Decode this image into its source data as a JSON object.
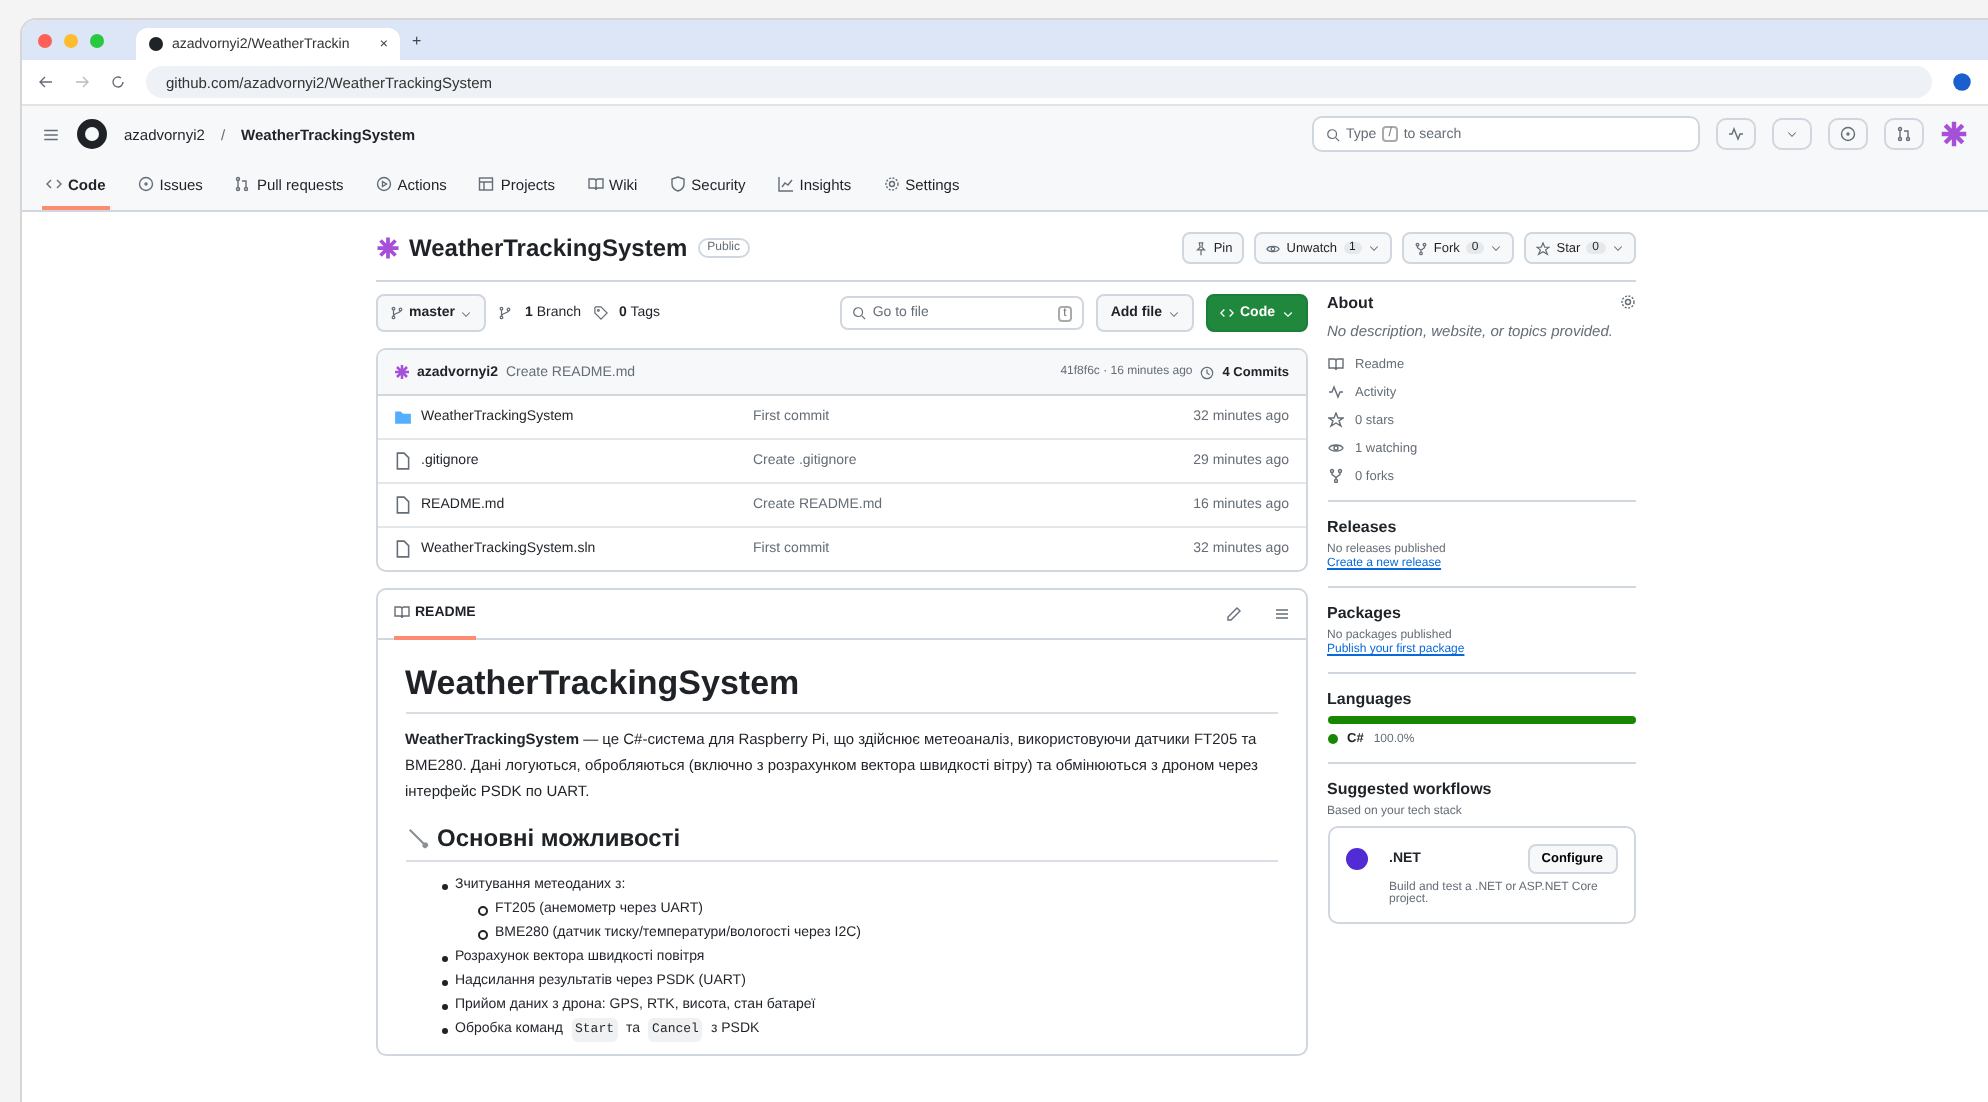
{
  "browser": {
    "tab_title": "azadvornyi2/WeatherTrackin",
    "tab_close": "×",
    "new_tab": "+",
    "url": "github.com/azadvornyi2/WeatherTrackingSystem"
  },
  "header": {
    "owner": "azadvornyi2",
    "separator": "/",
    "repo": "WeatherTrackingSystem",
    "search_prefix": "Type",
    "search_key": "/",
    "search_suffix": "to search"
  },
  "repo_nav": [
    {
      "label": "Code",
      "kind": "code",
      "selected": true
    },
    {
      "label": "Issues",
      "kind": "circle",
      "selected": false
    },
    {
      "label": "Pull requests",
      "kind": "pr",
      "selected": false
    },
    {
      "label": "Actions",
      "kind": "play",
      "selected": false
    },
    {
      "label": "Projects",
      "kind": "table",
      "selected": false
    },
    {
      "label": "Wiki",
      "kind": "book",
      "selected": false
    },
    {
      "label": "Security",
      "kind": "shield",
      "selected": false
    },
    {
      "label": "Insights",
      "kind": "graph",
      "selected": false
    },
    {
      "label": "Settings",
      "kind": "gear",
      "selected": false
    }
  ],
  "repo": {
    "name": "WeatherTrackingSystem",
    "visibility": "Public",
    "actions": [
      {
        "label": "Pin",
        "kind": "pin"
      },
      {
        "label": "Unwatch",
        "kind": "eye",
        "count": "1"
      },
      {
        "label": "Fork",
        "kind": "fork",
        "count": "0"
      },
      {
        "label": "Star",
        "kind": "star",
        "count": "0"
      }
    ]
  },
  "toolbar": {
    "branch": "master",
    "branches": "1",
    "branches_label": "Branch",
    "tags": "0",
    "tags_label": "Tags",
    "go_to_file": "Go to file",
    "shortcut": "t",
    "add_file": "Add file",
    "code": "Code"
  },
  "commit": {
    "author": "azadvornyi2",
    "message": "Create README.md",
    "meta": "41f8f6c · 16 minutes ago",
    "commits": "4 Commits"
  },
  "files": [
    {
      "kind": "folder",
      "name": "WeatherTrackingSystem",
      "message": "First commit",
      "time": "32 minutes ago"
    },
    {
      "kind": "file",
      "name": ".gitignore",
      "message": "Create .gitignore",
      "time": "29 minutes ago"
    },
    {
      "kind": "file",
      "name": "README.md",
      "message": "Create README.md",
      "time": "16 minutes ago"
    },
    {
      "kind": "file",
      "name": "WeatherTrackingSystem.sln",
      "message": "First commit",
      "time": "32 minutes ago"
    }
  ],
  "readme": {
    "tab": "README",
    "title": "WeatherTrackingSystem",
    "intro": "**WeatherTrackingSystem** — це C#-система для Raspberry Pi, що здійснює метеоаналіз, використовуючи датчики FT205 та BME280. Дані логуються, обробляються (включно з розрахунком вектора швидкості вітру) та обмінюються з дроном через інтерфейс PSDK по UART.",
    "heading": "Основні можливості",
    "items": [
      {
        "parts": [
          {
            "kind": "text",
            "text": "Зчитування метеоданих з:"
          }
        ],
        "children": [
          {
            "parts": [
              {
                "kind": "text",
                "text": "FT205 (анемометр через UART)"
              }
            ]
          },
          {
            "parts": [
              {
                "kind": "text",
                "text": "BME280 (датчик тиску/температури/вологості через I2C)"
              }
            ]
          }
        ]
      },
      {
        "parts": [
          {
            "kind": "text",
            "text": "Розрахунок вектора швидкості повітря"
          }
        ]
      },
      {
        "parts": [
          {
            "kind": "text",
            "text": "Надсилання результатів через PSDK (UART)"
          }
        ]
      },
      {
        "parts": [
          {
            "kind": "text",
            "text": "Прийом даних з дрона: GPS, RTK, висота, стан батареї"
          }
        ]
      },
      {
        "parts": [
          {
            "kind": "text",
            "text": "Обробка команд"
          },
          {
            "kind": "code",
            "text": "Start"
          },
          {
            "kind": "text",
            "text": "та"
          },
          {
            "kind": "code",
            "text": "Cancel"
          },
          {
            "kind": "text",
            "text": "з PSDK"
          }
        ]
      }
    ]
  },
  "sidebar": {
    "about": {
      "title": "About",
      "description": "No description, website, or topics provided.",
      "links": [
        {
          "kind": "book",
          "label": "Readme"
        },
        {
          "kind": "pulse",
          "label": "Activity"
        },
        {
          "kind": "star",
          "label": "0 stars"
        },
        {
          "kind": "eye",
          "label": "1 watching"
        },
        {
          "kind": "fork",
          "label": "0 forks"
        }
      ]
    },
    "releases": {
      "title": "Releases",
      "note": "No releases published",
      "link": "Create a new release"
    },
    "packages": {
      "title": "Packages",
      "note": "No packages published",
      "link": "Publish your first package"
    },
    "languages": {
      "title": "Languages",
      "items": [
        {
          "name": "C#",
          "percent": "100.0%",
          "level": 1,
          "color": "#178600"
        }
      ]
    },
    "workflows": {
      "title": "Suggested workflows",
      "subtitle": "Based on your tech stack",
      "items": [
        {
          "name": ".NET",
          "description": "Build and test a .NET or ASP.NET Core project.",
          "button": "Configure"
        }
      ]
    }
  }
}
